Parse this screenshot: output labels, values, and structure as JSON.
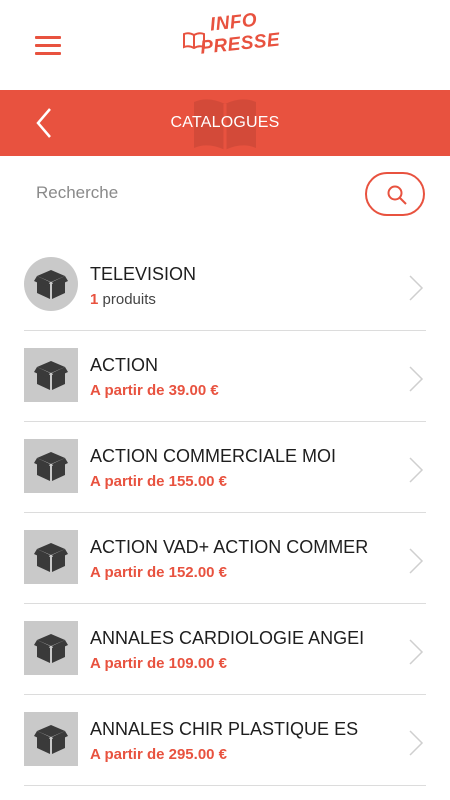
{
  "app": {
    "logo_line1": "INFO",
    "logo_line2": "PRESSE",
    "accent_color": "#e8523f"
  },
  "header": {
    "title": "CATALOGUES",
    "back_icon": "chevron-left-icon",
    "menu_icon": "hamburger-menu-icon"
  },
  "search": {
    "placeholder": "Recherche",
    "value": "",
    "icon": "search-icon"
  },
  "catalogues": [
    {
      "title": "TELEVISION",
      "count": "1",
      "count_label": "produits"
    },
    {
      "title": "ACTION",
      "price": "A partir de 39.00 €"
    },
    {
      "title": "ACTION COMMERCIALE MOI",
      "price": "A partir de 155.00 €"
    },
    {
      "title": "ACTION VAD+ ACTION COMMER",
      "price": "A partir de 152.00 €"
    },
    {
      "title": "ANNALES CARDIOLOGIE ANGEI",
      "price": "A partir de 109.00 €"
    },
    {
      "title": "ANNALES CHIR PLASTIQUE ES",
      "price": "A partir de 295.00 €"
    }
  ]
}
